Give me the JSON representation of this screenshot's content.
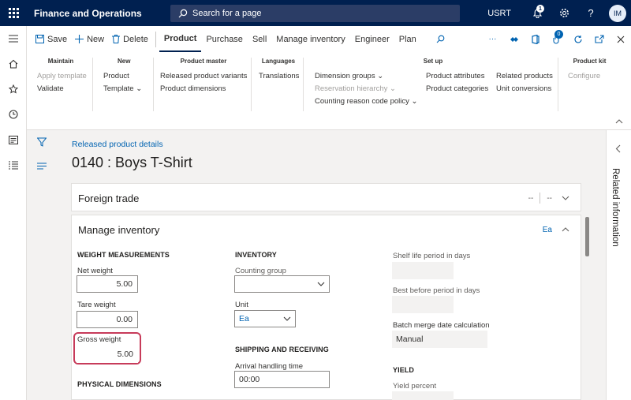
{
  "topbar": {
    "app_title": "Finance and Operations",
    "search_placeholder": "Search for a page",
    "company": "USRT",
    "notifications_count": "1",
    "avatar_initials": "IM"
  },
  "actionpane": {
    "save": "Save",
    "new": "New",
    "delete": "Delete",
    "tabs": [
      "Product",
      "Purchase",
      "Sell",
      "Manage inventory",
      "Engineer",
      "Plan"
    ],
    "office_badge": "0"
  },
  "groups": {
    "maintain": {
      "title": "Maintain",
      "items": [
        "Apply template",
        "Validate"
      ]
    },
    "new": {
      "title": "New",
      "items": [
        "Product",
        "Template"
      ]
    },
    "product_master": {
      "title": "Product master",
      "items": [
        "Released product variants",
        "Product dimensions"
      ]
    },
    "languages": {
      "title": "Languages",
      "items": [
        "Translations"
      ]
    },
    "setup": {
      "title": "Set up",
      "col1": [
        "Dimension groups",
        "Reservation hierarchy",
        "Counting reason code policy"
      ],
      "col2": [
        "Product attributes",
        "Product categories"
      ],
      "col3": [
        "Related products",
        "Unit conversions"
      ]
    },
    "product_kit": {
      "title": "Product kit",
      "items": [
        "Configure"
      ]
    }
  },
  "page": {
    "breadcrumb": "Released product details",
    "title": "0140 : Boys T-Shirt"
  },
  "foreign_trade": {
    "title": "Foreign trade",
    "summary1": "--",
    "summary2": "--"
  },
  "manage_inventory": {
    "title": "Manage inventory",
    "summary": "Ea",
    "weight_measurements": {
      "heading": "WEIGHT MEASUREMENTS",
      "net_weight_label": "Net weight",
      "net_weight": "5.00",
      "tare_weight_label": "Tare weight",
      "tare_weight": "0.00",
      "gross_weight_label": "Gross weight",
      "gross_weight": "5.00"
    },
    "physical_dimensions_heading": "PHYSICAL DIMENSIONS",
    "inventory": {
      "heading": "INVENTORY",
      "counting_group_label": "Counting group",
      "counting_group": "",
      "unit_label": "Unit",
      "unit": "Ea"
    },
    "shipping": {
      "heading": "SHIPPING AND RECEIVING",
      "arrival_label": "Arrival handling time",
      "arrival": "00:00"
    },
    "col3": {
      "shelf_life_label": "Shelf life period in days",
      "best_before_label": "Best before period in days",
      "batch_merge_label": "Batch merge date calculation",
      "batch_merge": "Manual",
      "yield_heading": "YIELD",
      "yield_percent_label": "Yield percent"
    }
  },
  "related": {
    "label": "Related information"
  }
}
